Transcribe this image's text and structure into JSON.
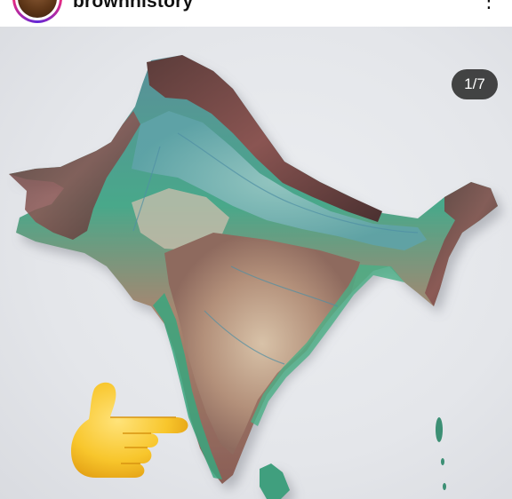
{
  "post": {
    "username": "brownhistory",
    "more_icon": "more-options-icon",
    "slide_counter": "1/7"
  },
  "media": {
    "description_icons": {
      "pointer": "backhand-index-pointing-right-emoji"
    }
  },
  "colors": {
    "background": "#e6e8ec",
    "mountains": "#7a4a45",
    "plains": "#5fa8a0",
    "coast": "#3fae86",
    "plateau": "#b08a6e",
    "counter_bg": "#1e1e1e",
    "emoji": "#f7c52b"
  }
}
